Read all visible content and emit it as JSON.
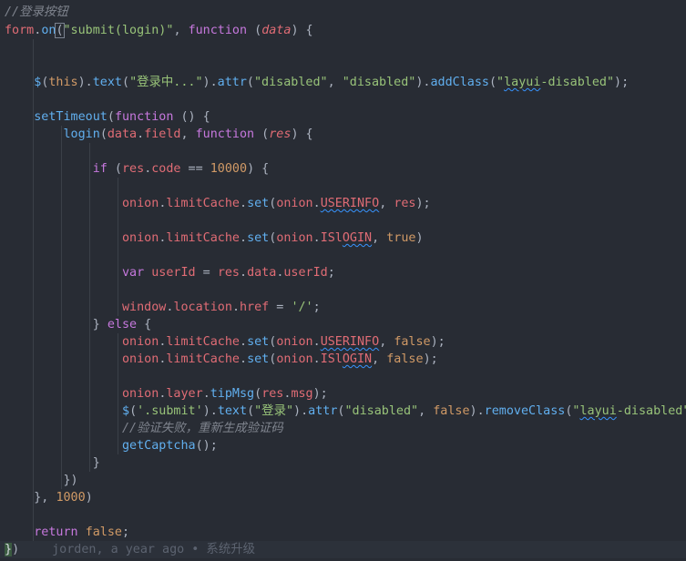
{
  "editor": {
    "lines": [
      {
        "t": [
          {
            "c": "c",
            "v": "//登录按钮"
          }
        ]
      },
      {
        "t": [
          {
            "c": "v",
            "v": "form"
          },
          {
            "c": "p",
            "v": "."
          },
          {
            "c": "f",
            "v": "on"
          },
          {
            "c": "p bm",
            "v": "("
          },
          {
            "c": "s",
            "v": "\"submit(login)\""
          },
          {
            "c": "p",
            "v": ", "
          },
          {
            "c": "k",
            "v": "function"
          },
          {
            "c": "p",
            "v": " ("
          },
          {
            "c": "pr",
            "v": "data"
          },
          {
            "c": "p",
            "v": ") {"
          }
        ]
      },
      {
        "t": []
      },
      {
        "t": []
      },
      {
        "t": [
          {
            "c": "p",
            "v": "    "
          },
          {
            "c": "f",
            "v": "$"
          },
          {
            "c": "p",
            "v": "("
          },
          {
            "c": "n",
            "v": "this"
          },
          {
            "c": "p",
            "v": ")."
          },
          {
            "c": "f",
            "v": "text"
          },
          {
            "c": "p",
            "v": "("
          },
          {
            "c": "s",
            "v": "\"登录中...\""
          },
          {
            "c": "p",
            "v": ")."
          },
          {
            "c": "f",
            "v": "attr"
          },
          {
            "c": "p",
            "v": "("
          },
          {
            "c": "s",
            "v": "\"disabled\""
          },
          {
            "c": "p",
            "v": ", "
          },
          {
            "c": "s",
            "v": "\"disabled\""
          },
          {
            "c": "p",
            "v": ")."
          },
          {
            "c": "f",
            "v": "addClass"
          },
          {
            "c": "p",
            "v": "("
          },
          {
            "c": "s",
            "v": "\""
          },
          {
            "c": "s sq",
            "v": "layui"
          },
          {
            "c": "s",
            "v": "-disabled\""
          },
          {
            "c": "p",
            "v": ");"
          }
        ]
      },
      {
        "t": []
      },
      {
        "t": [
          {
            "c": "p",
            "v": "    "
          },
          {
            "c": "f",
            "v": "setTimeout"
          },
          {
            "c": "p",
            "v": "("
          },
          {
            "c": "k",
            "v": "function"
          },
          {
            "c": "p",
            "v": " () {"
          }
        ]
      },
      {
        "t": [
          {
            "c": "p",
            "v": "        "
          },
          {
            "c": "f",
            "v": "login"
          },
          {
            "c": "p",
            "v": "("
          },
          {
            "c": "v",
            "v": "data"
          },
          {
            "c": "p",
            "v": "."
          },
          {
            "c": "v",
            "v": "field"
          },
          {
            "c": "p",
            "v": ", "
          },
          {
            "c": "k",
            "v": "function"
          },
          {
            "c": "p",
            "v": " ("
          },
          {
            "c": "pr",
            "v": "res"
          },
          {
            "c": "p",
            "v": ") {"
          }
        ]
      },
      {
        "t": []
      },
      {
        "t": [
          {
            "c": "p",
            "v": "            "
          },
          {
            "c": "k",
            "v": "if"
          },
          {
            "c": "p",
            "v": " ("
          },
          {
            "c": "v",
            "v": "res"
          },
          {
            "c": "p",
            "v": "."
          },
          {
            "c": "v",
            "v": "code"
          },
          {
            "c": "p",
            "v": " == "
          },
          {
            "c": "n",
            "v": "10000"
          },
          {
            "c": "p",
            "v": ") {"
          }
        ]
      },
      {
        "t": []
      },
      {
        "t": [
          {
            "c": "p",
            "v": "                "
          },
          {
            "c": "v",
            "v": "onion"
          },
          {
            "c": "p",
            "v": "."
          },
          {
            "c": "v",
            "v": "limitCache"
          },
          {
            "c": "p",
            "v": "."
          },
          {
            "c": "f",
            "v": "set"
          },
          {
            "c": "p",
            "v": "("
          },
          {
            "c": "v",
            "v": "onion"
          },
          {
            "c": "p",
            "v": "."
          },
          {
            "c": "v sq",
            "v": "USERINFO"
          },
          {
            "c": "p",
            "v": ", "
          },
          {
            "c": "v",
            "v": "res"
          },
          {
            "c": "p",
            "v": ");"
          }
        ]
      },
      {
        "t": []
      },
      {
        "t": [
          {
            "c": "p",
            "v": "                "
          },
          {
            "c": "v",
            "v": "onion"
          },
          {
            "c": "p",
            "v": "."
          },
          {
            "c": "v",
            "v": "limitCache"
          },
          {
            "c": "p",
            "v": "."
          },
          {
            "c": "f",
            "v": "set"
          },
          {
            "c": "p",
            "v": "("
          },
          {
            "c": "v",
            "v": "onion"
          },
          {
            "c": "p",
            "v": "."
          },
          {
            "c": "v",
            "v": "ISl"
          },
          {
            "c": "v sq",
            "v": "OGIN"
          },
          {
            "c": "p",
            "v": ", "
          },
          {
            "c": "n",
            "v": "true"
          },
          {
            "c": "p",
            "v": ")"
          }
        ]
      },
      {
        "t": []
      },
      {
        "t": [
          {
            "c": "p",
            "v": "                "
          },
          {
            "c": "k",
            "v": "var"
          },
          {
            "c": "p",
            "v": " "
          },
          {
            "c": "v",
            "v": "userId"
          },
          {
            "c": "p",
            "v": " = "
          },
          {
            "c": "v",
            "v": "res"
          },
          {
            "c": "p",
            "v": "."
          },
          {
            "c": "v",
            "v": "data"
          },
          {
            "c": "p",
            "v": "."
          },
          {
            "c": "v",
            "v": "userId"
          },
          {
            "c": "p",
            "v": ";"
          }
        ]
      },
      {
        "t": []
      },
      {
        "t": [
          {
            "c": "p",
            "v": "                "
          },
          {
            "c": "v",
            "v": "window"
          },
          {
            "c": "p",
            "v": "."
          },
          {
            "c": "v",
            "v": "location"
          },
          {
            "c": "p",
            "v": "."
          },
          {
            "c": "v",
            "v": "href"
          },
          {
            "c": "p",
            "v": " = "
          },
          {
            "c": "s",
            "v": "'/'"
          },
          {
            "c": "p",
            "v": ";"
          }
        ]
      },
      {
        "t": [
          {
            "c": "p",
            "v": "            } "
          },
          {
            "c": "k",
            "v": "else"
          },
          {
            "c": "p",
            "v": " {"
          }
        ]
      },
      {
        "t": [
          {
            "c": "p",
            "v": "                "
          },
          {
            "c": "v",
            "v": "onion"
          },
          {
            "c": "p",
            "v": "."
          },
          {
            "c": "v",
            "v": "limitCache"
          },
          {
            "c": "p",
            "v": "."
          },
          {
            "c": "f",
            "v": "set"
          },
          {
            "c": "p",
            "v": "("
          },
          {
            "c": "v",
            "v": "onion"
          },
          {
            "c": "p",
            "v": "."
          },
          {
            "c": "v sq",
            "v": "USERINFO"
          },
          {
            "c": "p",
            "v": ", "
          },
          {
            "c": "n",
            "v": "false"
          },
          {
            "c": "p",
            "v": ");"
          }
        ]
      },
      {
        "t": [
          {
            "c": "p",
            "v": "                "
          },
          {
            "c": "v",
            "v": "onion"
          },
          {
            "c": "p",
            "v": "."
          },
          {
            "c": "v",
            "v": "limitCache"
          },
          {
            "c": "p",
            "v": "."
          },
          {
            "c": "f",
            "v": "set"
          },
          {
            "c": "p",
            "v": "("
          },
          {
            "c": "v",
            "v": "onion"
          },
          {
            "c": "p",
            "v": "."
          },
          {
            "c": "v",
            "v": "ISl"
          },
          {
            "c": "v sq",
            "v": "OGIN"
          },
          {
            "c": "p",
            "v": ", "
          },
          {
            "c": "n",
            "v": "false"
          },
          {
            "c": "p",
            "v": ");"
          }
        ]
      },
      {
        "t": []
      },
      {
        "t": [
          {
            "c": "p",
            "v": "                "
          },
          {
            "c": "v",
            "v": "onion"
          },
          {
            "c": "p",
            "v": "."
          },
          {
            "c": "v",
            "v": "layer"
          },
          {
            "c": "p",
            "v": "."
          },
          {
            "c": "f",
            "v": "tipMsg"
          },
          {
            "c": "p",
            "v": "("
          },
          {
            "c": "v",
            "v": "res"
          },
          {
            "c": "p",
            "v": "."
          },
          {
            "c": "v",
            "v": "msg"
          },
          {
            "c": "p",
            "v": ");"
          }
        ]
      },
      {
        "t": [
          {
            "c": "p",
            "v": "                "
          },
          {
            "c": "f",
            "v": "$"
          },
          {
            "c": "p",
            "v": "("
          },
          {
            "c": "s",
            "v": "'.submit'"
          },
          {
            "c": "p",
            "v": ")."
          },
          {
            "c": "f",
            "v": "text"
          },
          {
            "c": "p",
            "v": "("
          },
          {
            "c": "s",
            "v": "\"登录\""
          },
          {
            "c": "p",
            "v": ")."
          },
          {
            "c": "f",
            "v": "attr"
          },
          {
            "c": "p",
            "v": "("
          },
          {
            "c": "s",
            "v": "\"disabled\""
          },
          {
            "c": "p",
            "v": ", "
          },
          {
            "c": "n",
            "v": "false"
          },
          {
            "c": "p",
            "v": ")."
          },
          {
            "c": "f",
            "v": "removeClass"
          },
          {
            "c": "p",
            "v": "("
          },
          {
            "c": "s",
            "v": "\""
          },
          {
            "c": "s sq",
            "v": "layui"
          },
          {
            "c": "s",
            "v": "-disabled\""
          },
          {
            "c": "p",
            "v": ");"
          }
        ]
      },
      {
        "t": [
          {
            "c": "p",
            "v": "                "
          },
          {
            "c": "c",
            "v": "//验证失败，重新生成验证码"
          }
        ]
      },
      {
        "t": [
          {
            "c": "p",
            "v": "                "
          },
          {
            "c": "f",
            "v": "getCaptcha"
          },
          {
            "c": "p",
            "v": "();"
          }
        ]
      },
      {
        "t": [
          {
            "c": "p",
            "v": "            }"
          }
        ]
      },
      {
        "t": [
          {
            "c": "p",
            "v": "        })"
          }
        ]
      },
      {
        "t": [
          {
            "c": "p",
            "v": "    }, "
          },
          {
            "c": "n",
            "v": "1000"
          },
          {
            "c": "p",
            "v": ")"
          }
        ]
      },
      {
        "t": []
      },
      {
        "t": [
          {
            "c": "p",
            "v": "    "
          },
          {
            "c": "k",
            "v": "return"
          },
          {
            "c": "p",
            "v": " "
          },
          {
            "c": "n",
            "v": "false"
          },
          {
            "c": "p",
            "v": ";"
          }
        ]
      },
      {
        "t": [
          {
            "c": "p hi",
            "v": "}"
          },
          {
            "c": "p",
            "v": ")"
          }
        ],
        "blame": "jorden, a year ago • 系统升级"
      }
    ]
  }
}
